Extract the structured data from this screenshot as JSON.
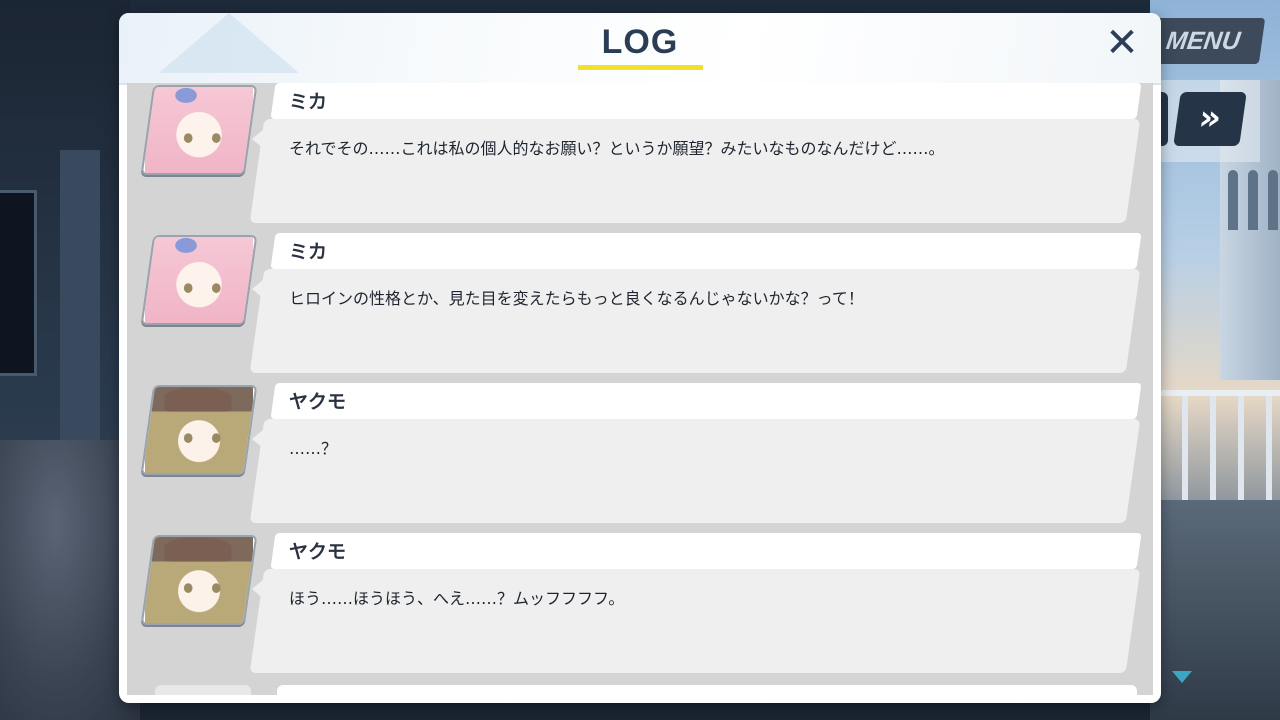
{
  "window": {
    "title": "LOG",
    "close_icon": "close-icon"
  },
  "hud": {
    "menu_label": "MENU",
    "fast_forward_icon": "fast-forward-icon"
  },
  "entries": [
    {
      "speaker": "ミカ",
      "text": "それでその……これは私の個人的なお願い？というか願望？みたいなものなんだけど……。",
      "avatar": "mika-portrait"
    },
    {
      "speaker": "ミカ",
      "text": "ヒロインの性格とか、見た目を変えたらもっと良くなるんじゃないかな？って！",
      "avatar": "mika-portrait"
    },
    {
      "speaker": "ヤクモ",
      "text": "……？",
      "avatar": "yakumo-portrait"
    },
    {
      "speaker": "ヤクモ",
      "text": "ほう……ほうほう、へえ……？ムッフフフフ。",
      "avatar": "yakumo-portrait"
    }
  ],
  "colors": {
    "accent_underline": "#f2e12a",
    "title": "#2b3d55",
    "list_bg": "#d4d4d4"
  }
}
